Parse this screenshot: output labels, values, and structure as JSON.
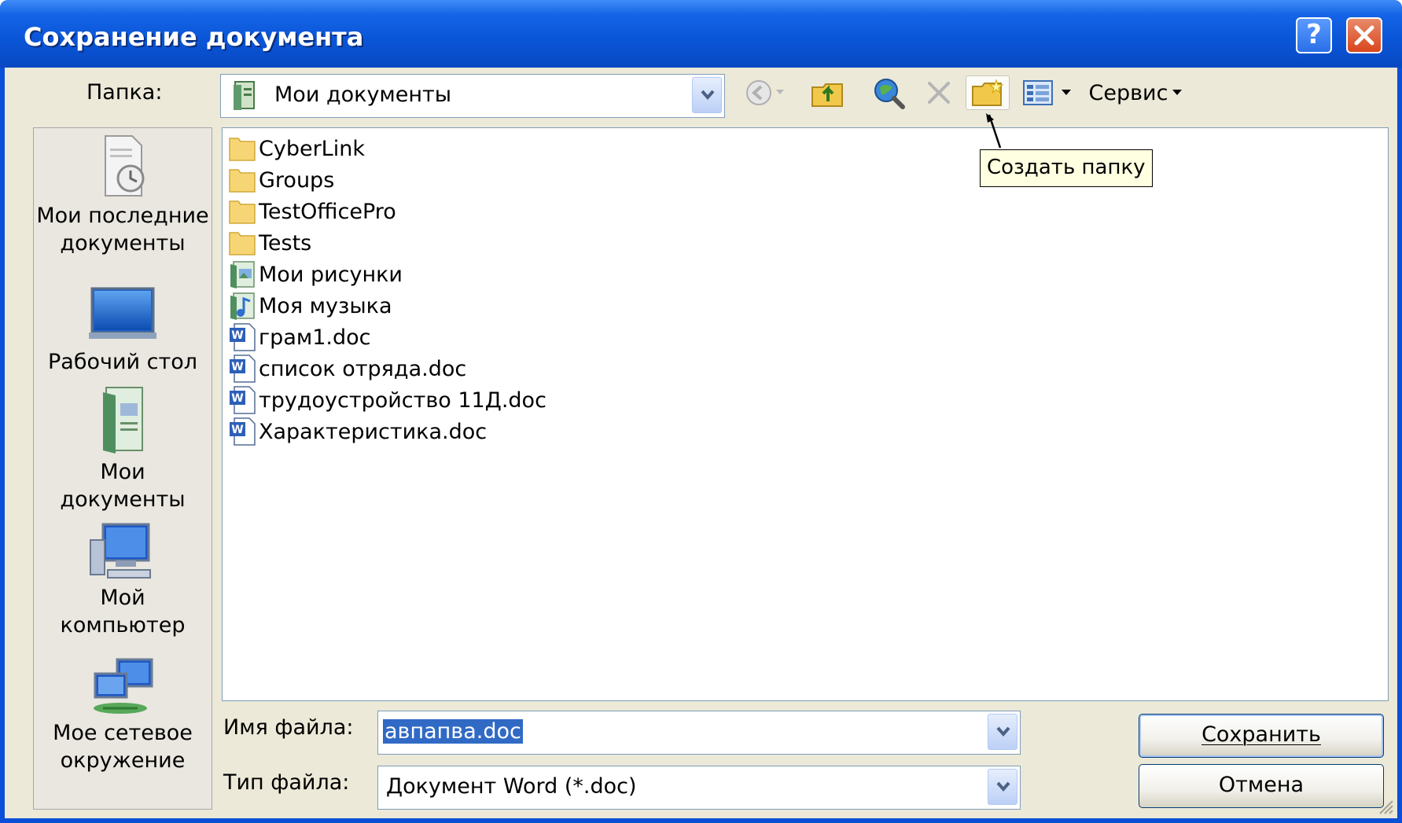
{
  "window": {
    "title": "Сохранение документа",
    "help_glyph": "?",
    "close_glyph": "✕"
  },
  "toolbar": {
    "folder_label": "Папка:",
    "current_folder": "Мои документы",
    "tools_menu": "Сервис",
    "icons": [
      "back-icon",
      "up-folder-icon",
      "search-web-icon",
      "delete-icon",
      "new-folder-icon",
      "views-icon"
    ]
  },
  "tooltip": {
    "text": "Создать папку"
  },
  "places": [
    {
      "label_1": "Мои последние",
      "label_2": "документы",
      "icon": "recent-documents-icon"
    },
    {
      "label_1": "Рабочий стол",
      "label_2": "",
      "icon": "desktop-icon"
    },
    {
      "label_1": "Мои",
      "label_2": "документы",
      "icon": "my-documents-icon"
    },
    {
      "label_1": "Мой",
      "label_2": "компьютер",
      "icon": "my-computer-icon"
    },
    {
      "label_1": "Мое сетевое",
      "label_2": "окружение",
      "icon": "network-places-icon"
    }
  ],
  "files": [
    {
      "name": "CyberLink",
      "type": "folder"
    },
    {
      "name": "Groups",
      "type": "folder"
    },
    {
      "name": "TestOfficePro",
      "type": "folder"
    },
    {
      "name": "Tests",
      "type": "folder"
    },
    {
      "name": "Мои рисунки",
      "type": "pictures-folder"
    },
    {
      "name": "Моя музыка",
      "type": "music-folder"
    },
    {
      "name": "грам1.doc",
      "type": "word-doc"
    },
    {
      "name": "список отряда.doc",
      "type": "word-doc"
    },
    {
      "name": "трудоустройство 11Д.doc",
      "type": "word-doc"
    },
    {
      "name": "Характеристика.doc",
      "type": "word-doc"
    }
  ],
  "filename": {
    "label": "Имя файла:",
    "value": "авпапва.doc"
  },
  "filetype": {
    "label": "Тип файла:",
    "value": "Документ Word (*.doc)"
  },
  "buttons": {
    "save": "Сохранить",
    "cancel": "Отмена"
  },
  "colors": {
    "title_blue": "#0a55d7",
    "dialog_bg": "#ece9d8",
    "selection": "#316ac5",
    "tooltip_bg": "#ffffe1"
  }
}
